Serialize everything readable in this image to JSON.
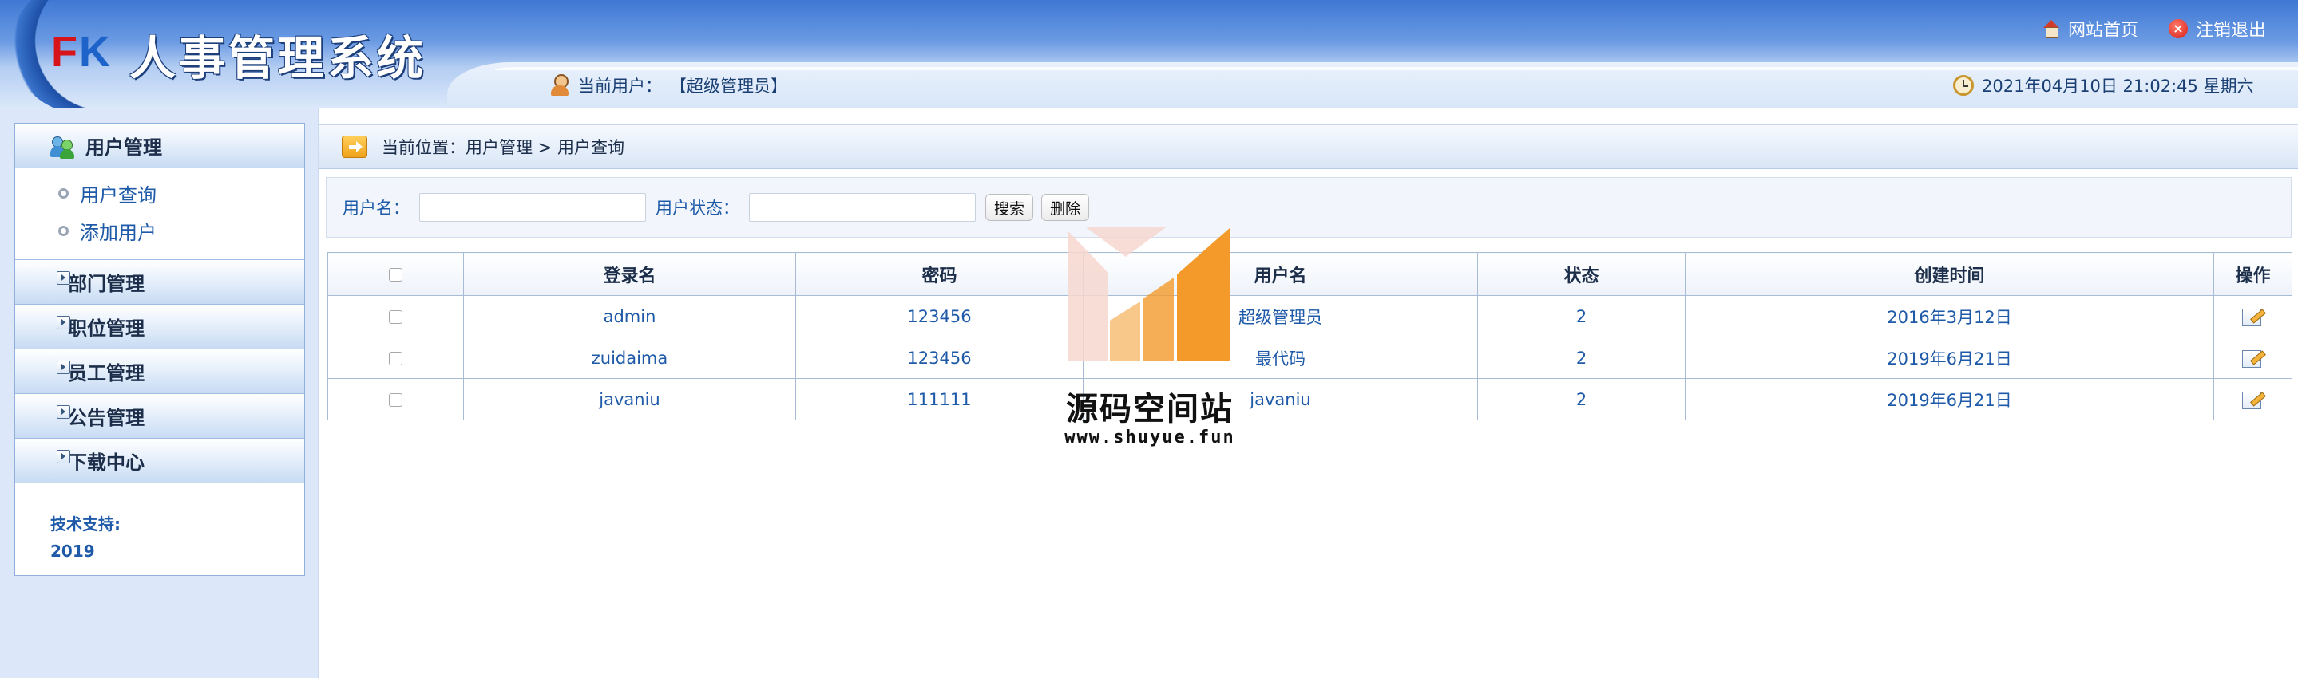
{
  "header": {
    "logo_f": "F",
    "logo_k": "K",
    "app_title": "人事管理系统",
    "home_link": "网站首页",
    "logout_link": "注销退出",
    "current_user_label": "当前用户：",
    "current_user": "【超级管理员】",
    "datetime": "2021年04月10日 21:02:45 星期六"
  },
  "sidebar": {
    "sections": [
      {
        "label": "用户管理",
        "icon": "users-icon",
        "expanded": true
      },
      {
        "label": "部门管理"
      },
      {
        "label": "职位管理"
      },
      {
        "label": "员工管理"
      },
      {
        "label": "公告管理"
      },
      {
        "label": "下载中心"
      }
    ],
    "user_items": [
      "用户查询",
      "添加用户"
    ],
    "support_label": "技术支持:",
    "support_value": "2019"
  },
  "breadcrumb": {
    "text": "当前位置：用户管理 > 用户查询"
  },
  "search": {
    "username_label": "用户名：",
    "username_value": "",
    "status_label": "用户状态：",
    "status_value": "",
    "search_button": "搜索",
    "delete_button": "删除"
  },
  "table": {
    "columns": [
      "",
      "登录名",
      "密码",
      "用户名",
      "状态",
      "创建时间",
      "操作"
    ],
    "rows": [
      {
        "login": "admin",
        "password": "123456",
        "username": "超级管理员",
        "status": "2",
        "created": "2016年3月12日"
      },
      {
        "login": "zuidaima",
        "password": "123456",
        "username": "最代码",
        "status": "2",
        "created": "2019年6月21日"
      },
      {
        "login": "javaniu",
        "password": "111111",
        "username": "javaniu",
        "status": "2",
        "created": "2019年6月21日"
      }
    ]
  },
  "watermark": {
    "title": "源码空间站",
    "url": "www.shuyue.fun",
    "colors": {
      "orange": "#f39a2b",
      "light": "#f6d7cf"
    }
  },
  "colors": {
    "header_blue": "#3f78d4",
    "link_blue": "#1e5aa8",
    "panel_bg": "#dce8fa"
  }
}
